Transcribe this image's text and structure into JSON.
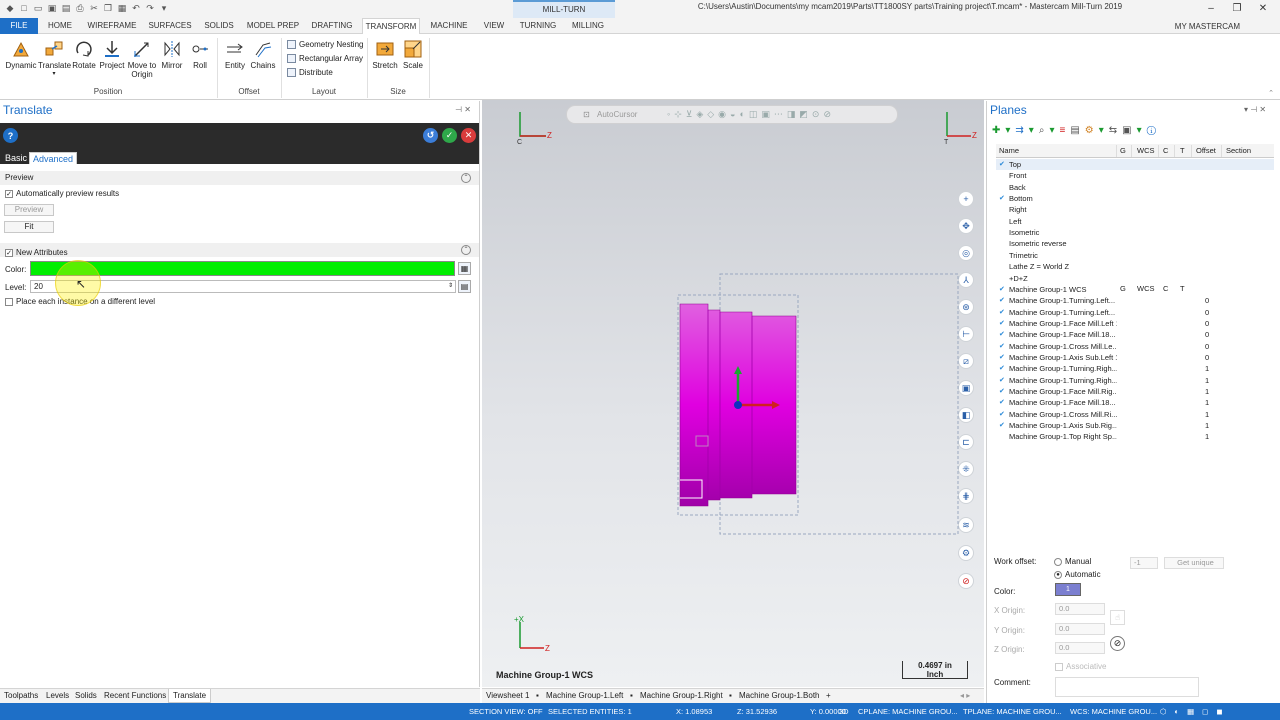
{
  "window": {
    "title": "C:\\Users\\Austin\\Documents\\my mcam2019\\Parts\\TT1800SY parts\\Training project\\T.mcam* - Mastercam Mill-Turn 2019",
    "contextual_tab": "MILL-TURN",
    "my_mastercam": "MY MASTERCAM"
  },
  "ribbon_tabs": [
    "FILE",
    "HOME",
    "WIREFRAME",
    "SURFACES",
    "SOLIDS",
    "MODEL PREP",
    "DRAFTING",
    "TRANSFORM",
    "MACHINE",
    "VIEW",
    "TURNING",
    "MILLING"
  ],
  "ribbon": {
    "position": {
      "label": "Position",
      "buttons": [
        "Dynamic",
        "Translate",
        "Rotate",
        "Project",
        "Move to Origin",
        "Mirror",
        "Roll"
      ]
    },
    "offset": {
      "label": "Offset",
      "buttons": [
        "Entity",
        "Chains"
      ]
    },
    "layout": {
      "label": "Layout",
      "items": [
        "Geometry Nesting",
        "Rectangular Array",
        "Distribute"
      ]
    },
    "size": {
      "label": "Size",
      "buttons": [
        "Stretch",
        "Scale"
      ]
    }
  },
  "translate_panel": {
    "title": "Translate",
    "tabs": [
      "Basic",
      "Advanced"
    ],
    "preview": {
      "heading": "Preview",
      "auto_preview": "Automatically preview results",
      "preview_btn": "Preview",
      "fit_btn": "Fit"
    },
    "attributes": {
      "new_attributes": "New Attributes",
      "color_label": "Color:",
      "color_value": "#00ee00",
      "level_label": "Level:",
      "level_value": "20",
      "place_each": "Place each instance on a different level"
    }
  },
  "viewport": {
    "toolbar_label": "AutoCursor",
    "group_label": "Machine Group-1 WCS",
    "scale_value": "0.4697 in",
    "scale_unit": "Inch",
    "axis_z": "Z",
    "axis_x": "X",
    "axis_c": "C",
    "axis_t": "T",
    "axis_plusx": "+X",
    "axis_plusz": "Z",
    "part_color": "#e000e0"
  },
  "planes": {
    "title": "Planes",
    "columns": [
      "Name",
      "G",
      "WCS",
      "C",
      "T",
      "Offset",
      "Section"
    ],
    "rows": [
      {
        "name": "Top",
        "check": "✔",
        "offset": ""
      },
      {
        "name": "Front",
        "check": "",
        "offset": ""
      },
      {
        "name": "Back",
        "check": "",
        "offset": ""
      },
      {
        "name": "Bottom",
        "check": "✔",
        "offset": ""
      },
      {
        "name": "Right",
        "check": "",
        "offset": ""
      },
      {
        "name": "Left",
        "check": "",
        "offset": ""
      },
      {
        "name": "Isometric",
        "check": "",
        "offset": ""
      },
      {
        "name": "Isometric reverse",
        "check": "",
        "offset": ""
      },
      {
        "name": "Trimetric",
        "check": "",
        "offset": ""
      },
      {
        "name": "Lathe Z = World Z",
        "check": "",
        "offset": ""
      },
      {
        "name": "+D+Z",
        "check": "",
        "offset": ""
      },
      {
        "name": "Machine Group-1 WCS",
        "check": "✔",
        "offset": ""
      },
      {
        "name": "Machine Group-1.Turning.Left...",
        "check": "✔",
        "offset": "0"
      },
      {
        "name": "Machine Group-1.Turning.Left...",
        "check": "✔",
        "offset": "0"
      },
      {
        "name": "Machine Group-1.Face Mill.Left 1",
        "check": "✔",
        "offset": "0"
      },
      {
        "name": "Machine Group-1.Face Mill.18...",
        "check": "✔",
        "offset": "0"
      },
      {
        "name": "Machine Group-1.Cross Mill.Le...",
        "check": "✔",
        "offset": "0"
      },
      {
        "name": "Machine Group-1.Axis Sub.Left 1",
        "check": "✔",
        "offset": "0"
      },
      {
        "name": "Machine Group-1.Turning.Righ...",
        "check": "✔",
        "offset": "1"
      },
      {
        "name": "Machine Group-1.Turning.Righ...",
        "check": "✔",
        "offset": "1"
      },
      {
        "name": "Machine Group-1.Face Mill.Rig...",
        "check": "✔",
        "offset": "1"
      },
      {
        "name": "Machine Group-1.Face Mill.18...",
        "check": "✔",
        "offset": "1"
      },
      {
        "name": "Machine Group-1.Cross Mill.Ri...",
        "check": "✔",
        "offset": "1"
      },
      {
        "name": "Machine Group-1.Axis Sub.Rig...",
        "check": "✔",
        "offset": "1"
      },
      {
        "name": "Machine Group-1.Top Right Sp...",
        "check": "",
        "offset": "1"
      }
    ],
    "wcs_row": {
      "g": "G",
      "wcs": "WCS",
      "c": "C",
      "t": "T"
    },
    "work_offset_label": "Work offset:",
    "manual": "Manual",
    "automatic": "Automatic",
    "offset_value": "-1",
    "get_unique": "Get unique",
    "color_label": "Color:",
    "color_value": "1",
    "color_swatch": "#7b7fd0",
    "x_origin_label": "X Origin:",
    "y_origin_label": "Y Origin:",
    "z_origin_label": "Z Origin:",
    "x_origin": "0.0",
    "y_origin": "0.0",
    "z_origin": "0.0",
    "associative": "Associative",
    "comment_label": "Comment:"
  },
  "bottom_tabs": [
    "Toolpaths",
    "Levels",
    "Solids",
    "Recent Functions",
    "Translate"
  ],
  "view_tabs": [
    "Viewsheet 1",
    "Machine Group-1.Left",
    "Machine Group-1.Right",
    "Machine Group-1.Both",
    "+"
  ],
  "status": {
    "section_view": "SECTION VIEW: OFF",
    "selected": "SELECTED ENTITIES: 1",
    "x": "X:   1.08953",
    "z": "Z:   31.52936",
    "y": "Y:   0.00000",
    "mode": "3D",
    "cplane": "CPLANE: MACHINE GROU...",
    "tplane": "TPLANE: MACHINE GROU...",
    "wcs": "WCS: MACHINE GROU..."
  }
}
